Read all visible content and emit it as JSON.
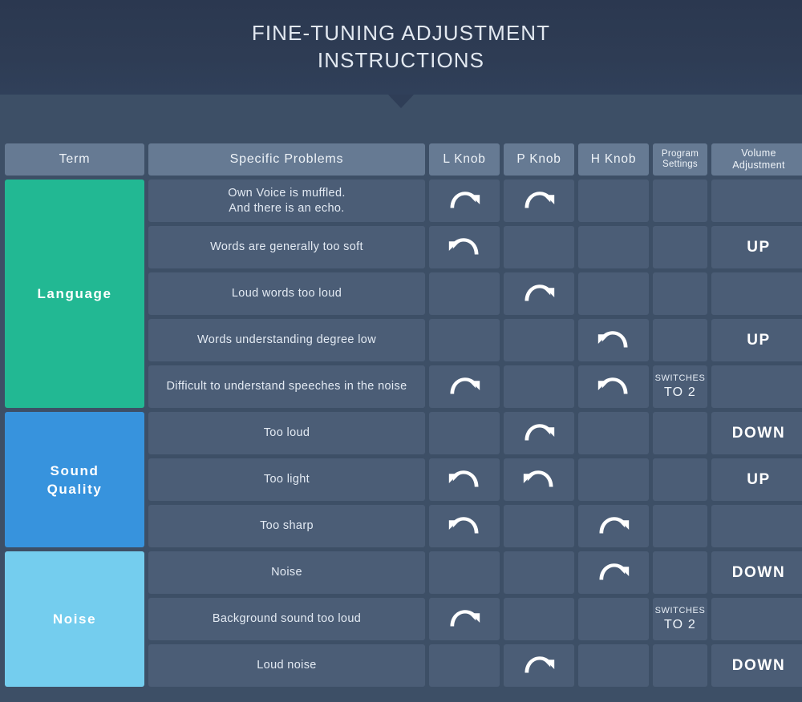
{
  "banner": {
    "title": "FINE-TUNING ADJUSTMENT\nINSTRUCTIONS"
  },
  "colors": {
    "background": "#3d4f66",
    "banner": "#2e3c54",
    "header_cell": "#667a93",
    "body_cell": "#4b5d76",
    "language": "#22b893",
    "sound_quality": "#3793dd",
    "noise": "#74cdee"
  },
  "table": {
    "headers": [
      {
        "label": "Term",
        "key": "term"
      },
      {
        "label": "Specific Problems",
        "key": "problem"
      },
      {
        "label": "L Knob",
        "key": "l_knob"
      },
      {
        "label": "P Knob",
        "key": "p_knob"
      },
      {
        "label": "H Knob",
        "key": "h_knob"
      },
      {
        "label": "Program\nSettings",
        "key": "program"
      },
      {
        "label": "Volume\nAdjustment",
        "key": "volume"
      }
    ],
    "groups": [
      {
        "term": "Language",
        "color": "#22b893",
        "rows": [
          {
            "problem": "Own Voice is muffled.\nAnd there is an echo.",
            "l_knob": "clockwise",
            "p_knob": "clockwise",
            "h_knob": "",
            "program": "",
            "volume": ""
          },
          {
            "problem": "Words are generally too soft",
            "l_knob": "counterclockwise",
            "p_knob": "",
            "h_knob": "",
            "program": "",
            "volume": "UP"
          },
          {
            "problem": "Loud words too loud",
            "l_knob": "",
            "p_knob": "clockwise",
            "h_knob": "",
            "program": "",
            "volume": ""
          },
          {
            "problem": "Words understanding degree low",
            "l_knob": "",
            "p_knob": "",
            "h_knob": "counterclockwise",
            "program": "",
            "volume": "UP"
          },
          {
            "problem": "Difficult to understand speeches in the noise",
            "l_knob": "clockwise",
            "p_knob": "",
            "h_knob": "counterclockwise",
            "program": "SWITCHES|TO 2",
            "volume": ""
          }
        ]
      },
      {
        "term": "Sound\nQuality",
        "color": "#3793dd",
        "rows": [
          {
            "problem": "Too loud",
            "l_knob": "",
            "p_knob": "clockwise",
            "h_knob": "",
            "program": "",
            "volume": "DOWN"
          },
          {
            "problem": "Too light",
            "l_knob": "counterclockwise",
            "p_knob": "counterclockwise",
            "h_knob": "",
            "program": "",
            "volume": "UP"
          },
          {
            "problem": "Too sharp",
            "l_knob": "counterclockwise",
            "p_knob": "",
            "h_knob": "clockwise",
            "program": "",
            "volume": ""
          }
        ]
      },
      {
        "term": "Noise",
        "color": "#74cdee",
        "rows": [
          {
            "problem": "Noise",
            "l_knob": "",
            "p_knob": "",
            "h_knob": "clockwise",
            "program": "",
            "volume": "DOWN"
          },
          {
            "problem": "Background sound too loud",
            "l_knob": "clockwise",
            "p_knob": "",
            "h_knob": "",
            "program": "SWITCHES|TO 2",
            "volume": ""
          },
          {
            "problem": "Loud noise",
            "l_knob": "",
            "p_knob": "clockwise",
            "h_knob": "",
            "program": "",
            "volume": "DOWN"
          }
        ]
      }
    ]
  },
  "icons": {
    "clockwise": "rotate-clockwise-arrow-icon",
    "counterclockwise": "rotate-counterclockwise-arrow-icon"
  }
}
